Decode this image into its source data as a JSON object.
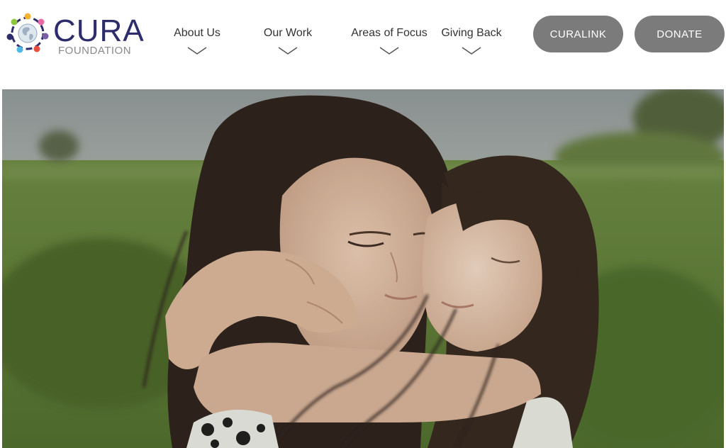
{
  "brand": {
    "name": "CURA",
    "sub": "FOUNDATION",
    "logo_colors": [
      "#2e2d6b",
      "#e86aa6",
      "#f2b233",
      "#4db8e6",
      "#8cc63f",
      "#e94e3c",
      "#7b5ea7"
    ]
  },
  "nav": {
    "items": [
      {
        "label": "About Us",
        "icon": "chevron-down-icon"
      },
      {
        "label": "Our Work",
        "icon": "chevron-down-icon"
      },
      {
        "label": "Areas of Focus",
        "icon": "chevron-down-icon"
      },
      {
        "label": "Giving Back",
        "icon": "chevron-down-icon"
      }
    ]
  },
  "actions": {
    "curalink_label": "CURALINK",
    "donate_label": "DONATE",
    "button_color": "#7b7b7b"
  },
  "hero": {
    "image": "hero-photo",
    "sky_color": "#9aa0a3",
    "field_color": "#5f7f36"
  }
}
